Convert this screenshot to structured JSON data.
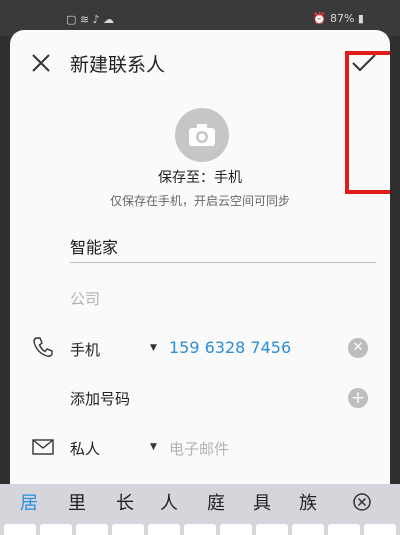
{
  "status_bar": {
    "battery": "87%"
  },
  "header": {
    "title": "新建联系人",
    "close_icon": "close-icon",
    "confirm_icon": "check-icon"
  },
  "save_info": {
    "label": "保存至：手机",
    "hint": "仅保存在手机，开启云空间可同步"
  },
  "form": {
    "name_value": "智能家",
    "company_placeholder": "公司",
    "phone": {
      "type": "手机",
      "number": "159 6328 7456"
    },
    "add_number_label": "添加号码",
    "email": {
      "type": "私人",
      "placeholder": "电子邮件"
    }
  },
  "keyboard": {
    "candidates": [
      "居",
      "里",
      "长",
      "人",
      "庭",
      "具",
      "族"
    ]
  },
  "colors": {
    "accent": "#2a8fd6",
    "highlight": "#e21b1b"
  }
}
